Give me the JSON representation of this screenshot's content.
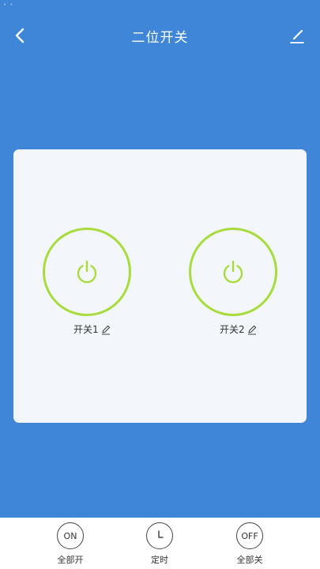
{
  "status_bar": {
    "indicator": "• •"
  },
  "header": {
    "title": "二位开关",
    "back_icon": "chevron-left-icon",
    "edit_icon": "pencil-icon"
  },
  "switches": [
    {
      "label": "开关1",
      "icon": "power-icon",
      "rename_icon": "pencil-icon"
    },
    {
      "label": "开关2",
      "icon": "power-icon",
      "rename_icon": "pencil-icon"
    }
  ],
  "bottom_bar": {
    "all_on": {
      "icon_text": "ON",
      "label": "全部开"
    },
    "timer": {
      "icon": "clock-icon",
      "label": "定时"
    },
    "all_off": {
      "icon_text": "OFF",
      "label": "全部关"
    }
  },
  "colors": {
    "background": "#3f86d8",
    "card": "#f3f6fb",
    "switch_ring": "#a8dc3e",
    "bottom_bar": "#ffffff"
  }
}
